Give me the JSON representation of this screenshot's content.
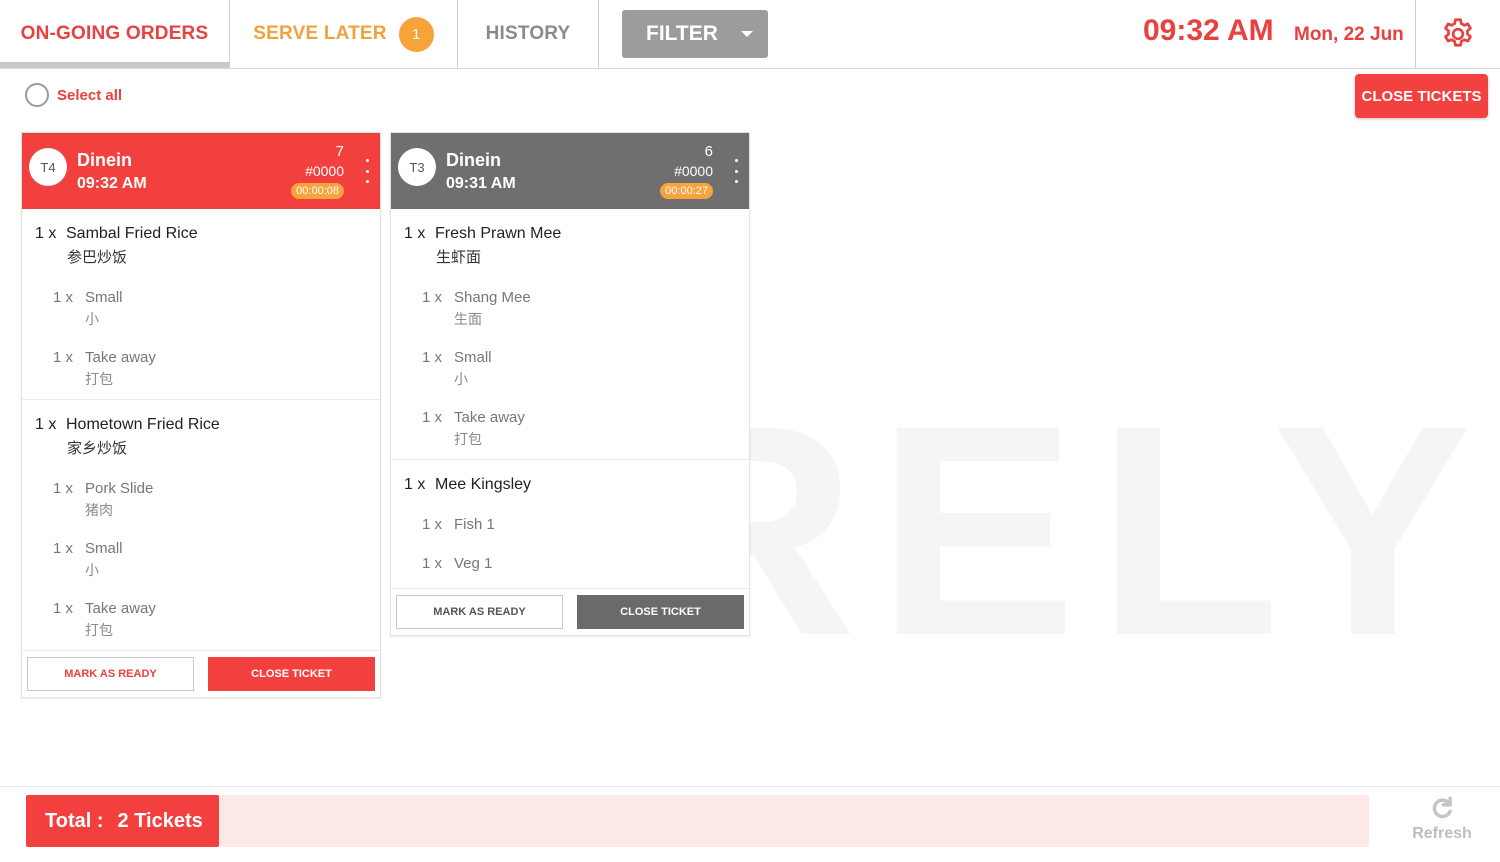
{
  "header": {
    "tabs": {
      "ongoing": "ON-GOING ORDERS",
      "serve_later": "SERVE LATER",
      "serve_later_count": "1",
      "history": "HISTORY"
    },
    "filter_label": "FILTER",
    "time": "09:32 AM",
    "date": "Mon, 22 Jun"
  },
  "toolbar": {
    "select_all": "Select all",
    "close_tickets": "CLOSE TICKETS"
  },
  "watermark": "RELY",
  "tickets": [
    {
      "table": "T4",
      "type": "Dinein",
      "time": "09:32 AM",
      "item_count": "7",
      "order_no": "#0000",
      "elapsed": "00:00:08",
      "items": [
        {
          "qty": "1 x",
          "name": "Sambal Fried Rice",
          "name_cn": "参巴炒饭",
          "mods": [
            {
              "qty": "1 x",
              "name": "Small",
              "name_cn": "小"
            },
            {
              "qty": "1 x",
              "name": "Take away",
              "name_cn": "打包"
            }
          ]
        },
        {
          "qty": "1 x",
          "name": "Hometown Fried Rice",
          "name_cn": "家乡炒饭",
          "mods": [
            {
              "qty": "1 x",
              "name": "Pork Slide",
              "name_cn": "猪肉"
            },
            {
              "qty": "1 x",
              "name": "Small",
              "name_cn": "小"
            },
            {
              "qty": "1 x",
              "name": "Take away",
              "name_cn": "打包"
            }
          ]
        }
      ],
      "mark_ready": "MARK AS READY",
      "close_ticket": "CLOSE TICKET"
    },
    {
      "table": "T3",
      "type": "Dinein",
      "time": "09:31 AM",
      "item_count": "6",
      "order_no": "#0000",
      "elapsed": "00:00:27",
      "items": [
        {
          "qty": "1 x",
          "name": "Fresh Prawn Mee",
          "name_cn": "生虾面",
          "mods": [
            {
              "qty": "1 x",
              "name": "Shang Mee",
              "name_cn": "生面"
            },
            {
              "qty": "1 x",
              "name": "Small",
              "name_cn": "小"
            },
            {
              "qty": "1 x",
              "name": "Take away",
              "name_cn": "打包"
            }
          ]
        },
        {
          "qty": "1 x",
          "name": "Mee Kingsley",
          "name_cn": "",
          "mods": [
            {
              "qty": "1 x",
              "name": "Fish 1",
              "name_cn": ""
            },
            {
              "qty": "1 x",
              "name": "Veg 1",
              "name_cn": ""
            }
          ]
        }
      ],
      "mark_ready": "MARK AS READY",
      "close_ticket": "CLOSE TICKET"
    }
  ],
  "footer": {
    "total_label": "Total :",
    "total_value": "2 Tickets",
    "refresh": "Refresh"
  },
  "colors": {
    "accent_red": "#f2403e",
    "serve_later_orange": "#f0a23c",
    "ticket_grey": "#6f6f6f"
  }
}
